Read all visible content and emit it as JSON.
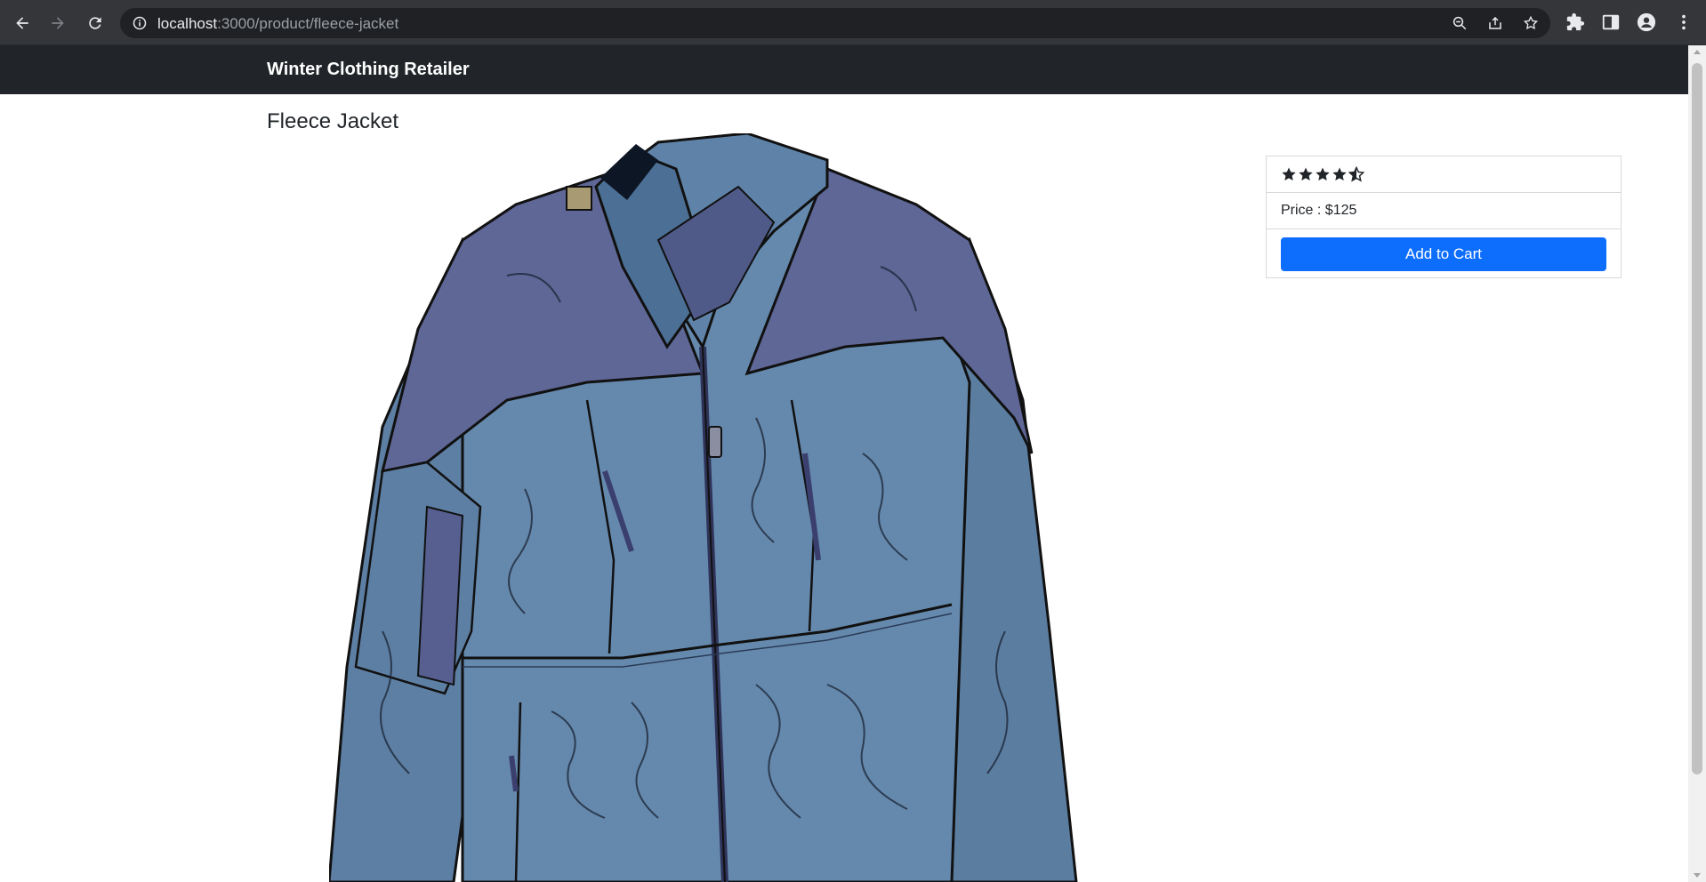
{
  "browser": {
    "url_host": "localhost",
    "url_rest": ":3000/product/fleece-jacket",
    "icons": [
      "back-icon",
      "forward-icon",
      "reload-icon",
      "site-info-icon",
      "zoom-icon",
      "share-icon",
      "bookmark-star-icon",
      "extensions-icon",
      "side-panel-icon",
      "profile-icon",
      "menu-icon"
    ]
  },
  "navbar": {
    "brand": "Winter Clothing Retailer",
    "background": "#212529"
  },
  "product": {
    "title": "Fleece Jacket",
    "rating": 4.5,
    "rating_max": 5,
    "price_label": "Price : $125",
    "add_to_cart": "Add to Cart",
    "button_color": "#0d6efd"
  }
}
